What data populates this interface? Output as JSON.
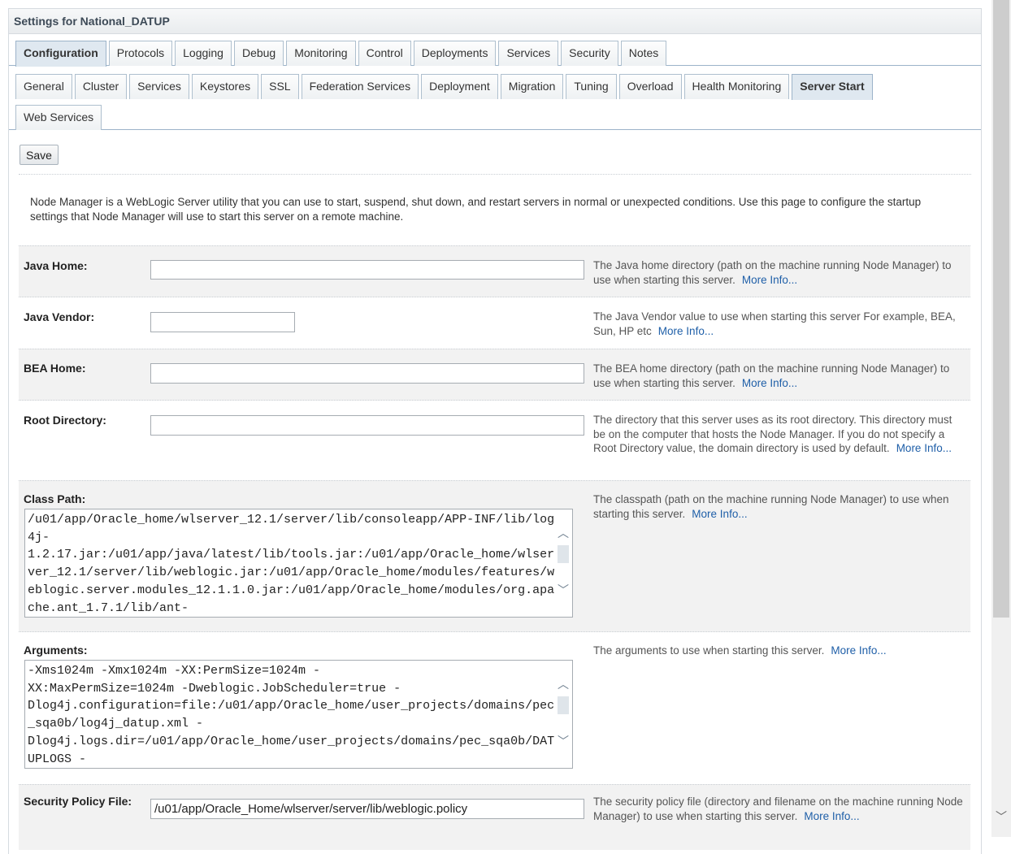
{
  "panel_title": "Settings for National_DATUP",
  "main_tabs": [
    "Configuration",
    "Protocols",
    "Logging",
    "Debug",
    "Monitoring",
    "Control",
    "Deployments",
    "Services",
    "Security",
    "Notes"
  ],
  "sub_tabs_row1": [
    "General",
    "Cluster",
    "Services",
    "Keystores",
    "SSL",
    "Federation Services",
    "Deployment",
    "Migration",
    "Tuning",
    "Overload",
    "Health Monitoring",
    "Server Start"
  ],
  "sub_tabs_row2": [
    "Web Services"
  ],
  "active_main_tab": "Configuration",
  "active_sub_tab": "Server Start",
  "save_label": "Save",
  "intro_text": "Node Manager is a WebLogic Server utility that you can use to start, suspend, shut down, and restart servers in normal or unexpected conditions. Use this page to configure the startup settings that Node Manager will use to start this server on a remote machine.",
  "more_info": "More Info...",
  "fields": {
    "java_home": {
      "label": "Java Home:",
      "value": "",
      "help": "The Java home directory (path on the machine running Node Manager) to use when starting this server."
    },
    "java_vendor": {
      "label": "Java Vendor:",
      "value": "",
      "help": "The Java Vendor value to use when starting this server For example, BEA, Sun, HP etc"
    },
    "bea_home": {
      "label": "BEA Home:",
      "value": "",
      "help": "The BEA home directory (path on the machine running Node Manager) to use when starting this server."
    },
    "root_directory": {
      "label": "Root Directory:",
      "value": "",
      "help": "The directory that this server uses as its root directory. This directory must be on the computer that hosts the Node Manager. If you do not specify a Root Directory value, the domain directory is used by default."
    },
    "class_path": {
      "label": "Class Path:",
      "value": "/u01/app/Oracle_home/wlserver_12.1/server/lib/consoleapp/APP-INF/lib/log4j-\n1.2.17.jar:/u01/app/java/latest/lib/tools.jar:/u01/app/Oracle_home/wlserver_12.1/server/lib/weblogic.jar:/u01/app/Oracle_home/modules/features/weblogic.server.modules_12.1.1.0.jar:/u01/app/Oracle_home/modules/org.apache.ant_1.7.1/lib/ant-",
      "help": "The classpath (path on the machine running Node Manager) to use when starting this server."
    },
    "arguments": {
      "label": "Arguments:",
      "value": "-Xms1024m -Xmx1024m -XX:PermSize=1024m -\nXX:MaxPermSize=1024m -Dweblogic.JobScheduler=true -\nDlog4j.configuration=file:/u01/app/Oracle_home/user_projects/domains/pec_sqa0b/log4j_datup.xml -\nDlog4j.logs.dir=/u01/app/Oracle_home/user_projects/domains/pec_sqa0b/DATUPLOGS -",
      "help": "The arguments to use when starting this server."
    },
    "security_policy": {
      "label": "Security Policy File:",
      "value": "/u01/app/Oracle_Home/wlserver/server/lib/weblogic.policy",
      "help": "The security policy file (directory and filename on the machine running Node Manager) to use when starting this server."
    }
  }
}
